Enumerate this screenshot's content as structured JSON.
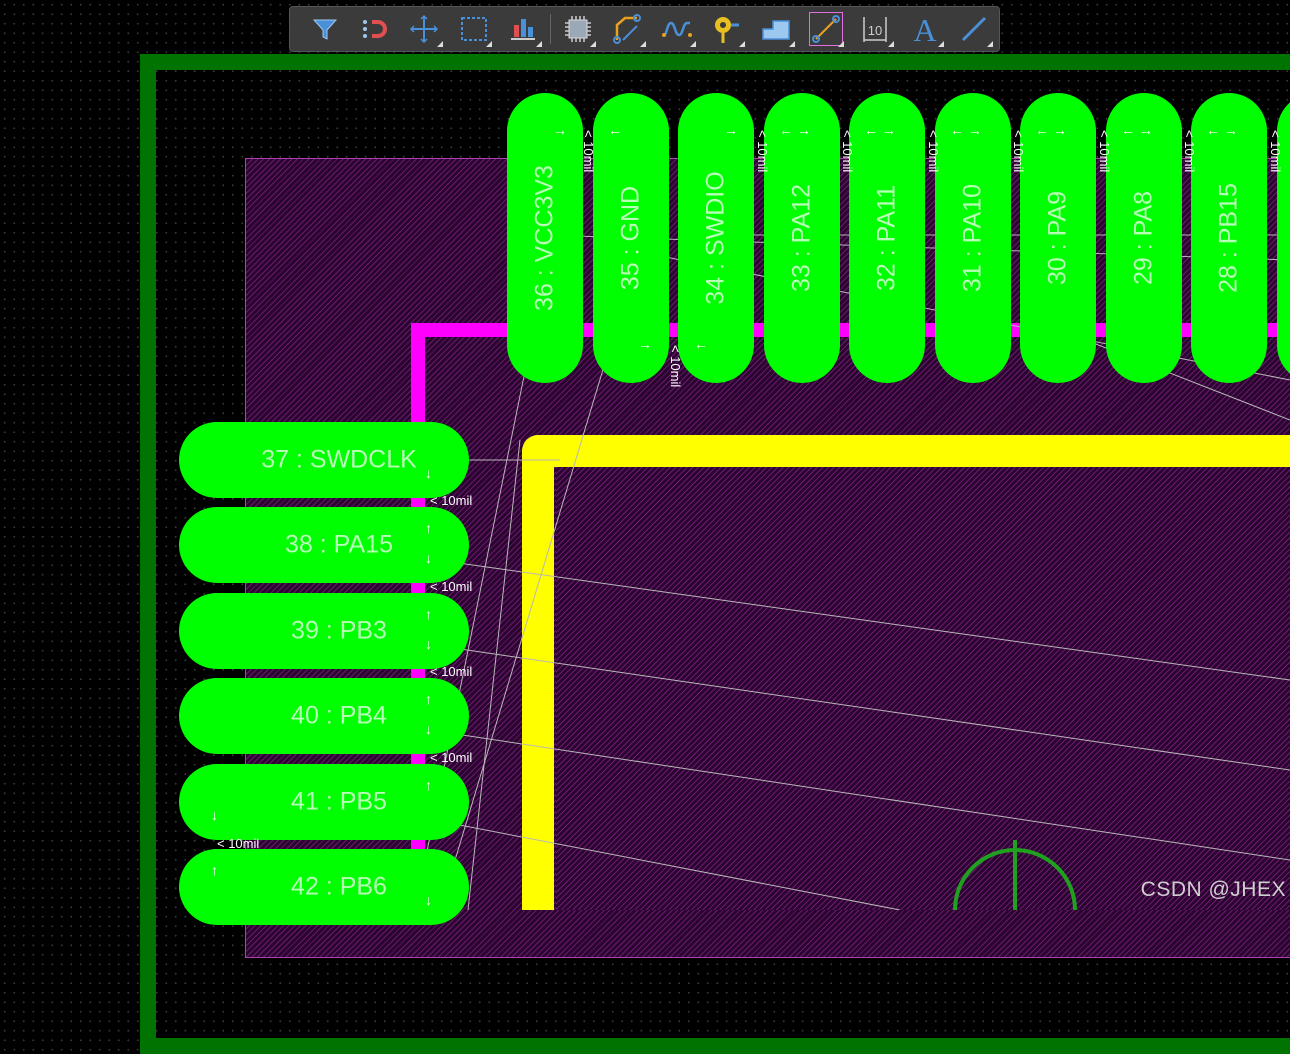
{
  "toolbar": {
    "tools": [
      {
        "icon": "filter-icon"
      },
      {
        "icon": "snap-magnet-icon"
      },
      {
        "icon": "move-crosshair-icon"
      },
      {
        "icon": "select-rect-icon"
      },
      {
        "icon": "align-icon"
      },
      {
        "icon": "component-icon"
      },
      {
        "icon": "route-track-icon"
      },
      {
        "icon": "interactive-route-icon"
      },
      {
        "icon": "via-icon"
      },
      {
        "icon": "polygon-pour-icon"
      },
      {
        "icon": "track-selected-icon"
      },
      {
        "icon": "dimension-icon",
        "label": "10"
      },
      {
        "icon": "text-icon",
        "label": "A"
      },
      {
        "icon": "line-icon"
      }
    ]
  },
  "pads_top": [
    {
      "label": "36 : VCC3V3"
    },
    {
      "label": "35 : GND"
    },
    {
      "label": "34 : SWDIO"
    },
    {
      "label": "33 : PA12"
    },
    {
      "label": "32 : PA11"
    },
    {
      "label": "31 : PA10"
    },
    {
      "label": "30 : PA9"
    },
    {
      "label": "29 : PA8"
    },
    {
      "label": "28 : PB15"
    }
  ],
  "pads_left": [
    {
      "label": "37 : SWDCLK"
    },
    {
      "label": "38 : PA15"
    },
    {
      "label": "39 : PB3"
    },
    {
      "label": "40 : PB4"
    },
    {
      "label": "41 : PB5"
    },
    {
      "label": "42 : PB6"
    }
  ],
  "clearance_rule": "< 10mil",
  "watermark": "CSDN @JHEX",
  "colors": {
    "pad": "#00ff00",
    "board_outline": "#007300",
    "top_overlay": "#ffff00",
    "track": "#ff00ff",
    "keepout_hatch": "#a028a0",
    "toolbar_bg": "#3b3b3b"
  }
}
